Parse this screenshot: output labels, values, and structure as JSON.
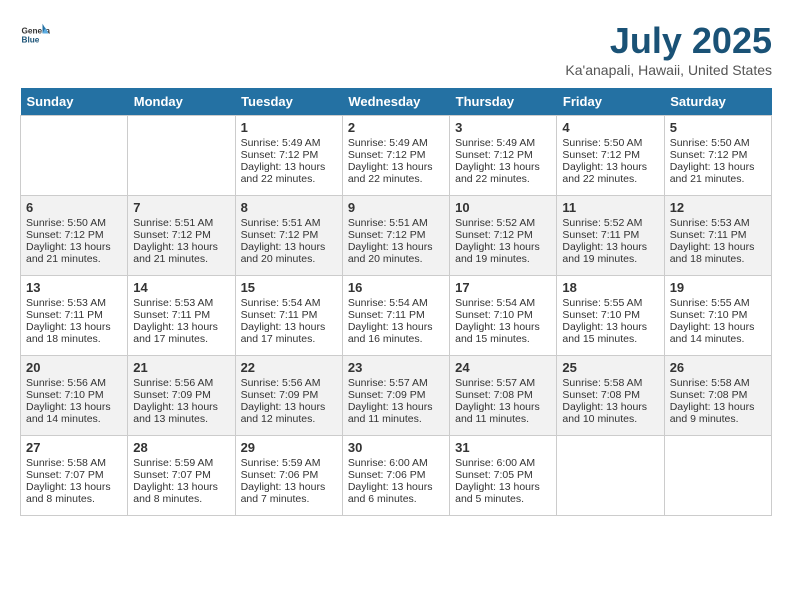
{
  "header": {
    "logo_general": "General",
    "logo_blue": "Blue",
    "title": "July 2025",
    "subtitle": "Ka'anapali, Hawaii, United States"
  },
  "weekdays": [
    "Sunday",
    "Monday",
    "Tuesday",
    "Wednesday",
    "Thursday",
    "Friday",
    "Saturday"
  ],
  "weeks": [
    [
      {
        "day": "",
        "empty": true
      },
      {
        "day": "",
        "empty": true
      },
      {
        "day": "1",
        "sunrise": "5:49 AM",
        "sunset": "7:12 PM",
        "daylight": "13 hours and 22 minutes."
      },
      {
        "day": "2",
        "sunrise": "5:49 AM",
        "sunset": "7:12 PM",
        "daylight": "13 hours and 22 minutes."
      },
      {
        "day": "3",
        "sunrise": "5:49 AM",
        "sunset": "7:12 PM",
        "daylight": "13 hours and 22 minutes."
      },
      {
        "day": "4",
        "sunrise": "5:50 AM",
        "sunset": "7:12 PM",
        "daylight": "13 hours and 22 minutes."
      },
      {
        "day": "5",
        "sunrise": "5:50 AM",
        "sunset": "7:12 PM",
        "daylight": "13 hours and 21 minutes."
      }
    ],
    [
      {
        "day": "6",
        "sunrise": "5:50 AM",
        "sunset": "7:12 PM",
        "daylight": "13 hours and 21 minutes."
      },
      {
        "day": "7",
        "sunrise": "5:51 AM",
        "sunset": "7:12 PM",
        "daylight": "13 hours and 21 minutes."
      },
      {
        "day": "8",
        "sunrise": "5:51 AM",
        "sunset": "7:12 PM",
        "daylight": "13 hours and 20 minutes."
      },
      {
        "day": "9",
        "sunrise": "5:51 AM",
        "sunset": "7:12 PM",
        "daylight": "13 hours and 20 minutes."
      },
      {
        "day": "10",
        "sunrise": "5:52 AM",
        "sunset": "7:12 PM",
        "daylight": "13 hours and 19 minutes."
      },
      {
        "day": "11",
        "sunrise": "5:52 AM",
        "sunset": "7:11 PM",
        "daylight": "13 hours and 19 minutes."
      },
      {
        "day": "12",
        "sunrise": "5:53 AM",
        "sunset": "7:11 PM",
        "daylight": "13 hours and 18 minutes."
      }
    ],
    [
      {
        "day": "13",
        "sunrise": "5:53 AM",
        "sunset": "7:11 PM",
        "daylight": "13 hours and 18 minutes."
      },
      {
        "day": "14",
        "sunrise": "5:53 AM",
        "sunset": "7:11 PM",
        "daylight": "13 hours and 17 minutes."
      },
      {
        "day": "15",
        "sunrise": "5:54 AM",
        "sunset": "7:11 PM",
        "daylight": "13 hours and 17 minutes."
      },
      {
        "day": "16",
        "sunrise": "5:54 AM",
        "sunset": "7:11 PM",
        "daylight": "13 hours and 16 minutes."
      },
      {
        "day": "17",
        "sunrise": "5:54 AM",
        "sunset": "7:10 PM",
        "daylight": "13 hours and 15 minutes."
      },
      {
        "day": "18",
        "sunrise": "5:55 AM",
        "sunset": "7:10 PM",
        "daylight": "13 hours and 15 minutes."
      },
      {
        "day": "19",
        "sunrise": "5:55 AM",
        "sunset": "7:10 PM",
        "daylight": "13 hours and 14 minutes."
      }
    ],
    [
      {
        "day": "20",
        "sunrise": "5:56 AM",
        "sunset": "7:10 PM",
        "daylight": "13 hours and 14 minutes."
      },
      {
        "day": "21",
        "sunrise": "5:56 AM",
        "sunset": "7:09 PM",
        "daylight": "13 hours and 13 minutes."
      },
      {
        "day": "22",
        "sunrise": "5:56 AM",
        "sunset": "7:09 PM",
        "daylight": "13 hours and 12 minutes."
      },
      {
        "day": "23",
        "sunrise": "5:57 AM",
        "sunset": "7:09 PM",
        "daylight": "13 hours and 11 minutes."
      },
      {
        "day": "24",
        "sunrise": "5:57 AM",
        "sunset": "7:08 PM",
        "daylight": "13 hours and 11 minutes."
      },
      {
        "day": "25",
        "sunrise": "5:58 AM",
        "sunset": "7:08 PM",
        "daylight": "13 hours and 10 minutes."
      },
      {
        "day": "26",
        "sunrise": "5:58 AM",
        "sunset": "7:08 PM",
        "daylight": "13 hours and 9 minutes."
      }
    ],
    [
      {
        "day": "27",
        "sunrise": "5:58 AM",
        "sunset": "7:07 PM",
        "daylight": "13 hours and 8 minutes."
      },
      {
        "day": "28",
        "sunrise": "5:59 AM",
        "sunset": "7:07 PM",
        "daylight": "13 hours and 8 minutes."
      },
      {
        "day": "29",
        "sunrise": "5:59 AM",
        "sunset": "7:06 PM",
        "daylight": "13 hours and 7 minutes."
      },
      {
        "day": "30",
        "sunrise": "6:00 AM",
        "sunset": "7:06 PM",
        "daylight": "13 hours and 6 minutes."
      },
      {
        "day": "31",
        "sunrise": "6:00 AM",
        "sunset": "7:05 PM",
        "daylight": "13 hours and 5 minutes."
      },
      {
        "day": "",
        "empty": true
      },
      {
        "day": "",
        "empty": true
      }
    ]
  ]
}
